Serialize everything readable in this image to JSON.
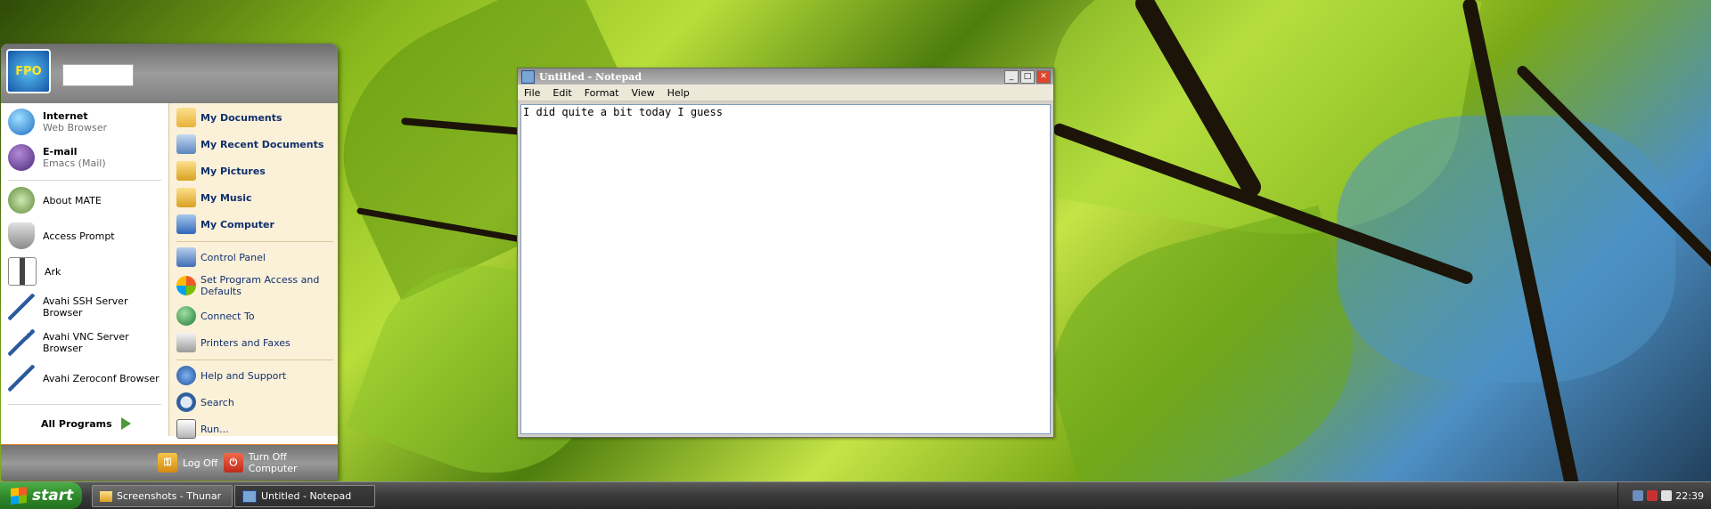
{
  "start_menu": {
    "pinned": [
      {
        "label": "Internet",
        "sub": "Web Browser",
        "icon": "internet-icon"
      },
      {
        "label": "E-mail",
        "sub": "Emacs (Mail)",
        "icon": "email-icon"
      }
    ],
    "recent": [
      {
        "label": "About MATE",
        "icon": "mate-icon"
      },
      {
        "label": "Access Prompt",
        "icon": "shield-icon"
      },
      {
        "label": "Ark",
        "icon": "archive-icon"
      },
      {
        "label": "Avahi SSH Server Browser",
        "icon": "network-icon"
      },
      {
        "label": "Avahi VNC Server Browser",
        "icon": "network-icon"
      },
      {
        "label": "Avahi Zeroconf Browser",
        "icon": "network-icon"
      }
    ],
    "all_programs": "All Programs",
    "right_items": [
      {
        "label": "My Documents",
        "icon": "folder-documents-icon"
      },
      {
        "label": "My Recent Documents",
        "icon": "recent-documents-icon"
      },
      {
        "label": "My Pictures",
        "icon": "folder-pictures-icon"
      },
      {
        "label": "My Music",
        "icon": "folder-music-icon"
      },
      {
        "label": "My Computer",
        "icon": "computer-icon"
      }
    ],
    "right_items_2": [
      {
        "label": "Control Panel",
        "icon": "control-panel-icon"
      },
      {
        "label": "Set Program Access and Defaults",
        "icon": "defaults-icon"
      },
      {
        "label": "Connect To",
        "icon": "connect-icon"
      },
      {
        "label": "Printers and Faxes",
        "icon": "printer-icon"
      }
    ],
    "right_items_3": [
      {
        "label": "Help and Support",
        "icon": "help-icon"
      },
      {
        "label": "Search",
        "icon": "search-icon"
      },
      {
        "label": "Run...",
        "icon": "run-icon"
      }
    ],
    "log_off": "Log Off",
    "turn_off": "Turn Off Computer",
    "avatar_text": "FPO"
  },
  "notepad": {
    "title": "Untitled - Notepad",
    "menu": [
      "File",
      "Edit",
      "Format",
      "View",
      "Help"
    ],
    "content": "I did quite a bit today I guess"
  },
  "taskbar": {
    "start_label": "start",
    "buttons": [
      {
        "label": "Screenshots - Thunar",
        "icon": "folder-icon"
      },
      {
        "label": "Untitled - Notepad",
        "icon": "notepad-icon"
      }
    ],
    "clock": "22:39"
  }
}
